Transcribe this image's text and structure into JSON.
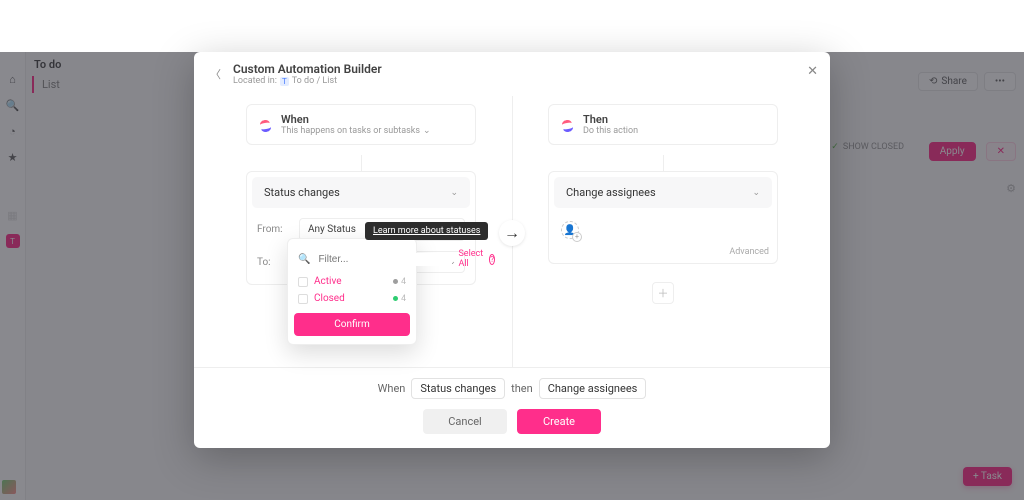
{
  "colors": {
    "accent": "#ff2e8b"
  },
  "background": {
    "title": "To do",
    "tab": "List",
    "share": "Share",
    "apply": "Apply",
    "show_closed": "SHOW CLOSED",
    "add_task": "+ Task"
  },
  "modal": {
    "title": "Custom Automation Builder",
    "located_prefix": "Located in:",
    "located_badge": "T",
    "located_path": "To do / List",
    "when": {
      "title": "When",
      "subtitle": "This happens on tasks or subtasks",
      "trigger": "Status changes",
      "from_label": "From:",
      "from_value": "Any Status",
      "to_label": "To:"
    },
    "then": {
      "title": "Then",
      "subtitle": "Do this action",
      "action": "Change assignees",
      "advanced": "Advanced"
    },
    "dropdown": {
      "placeholder": "Filter...",
      "select_all": "Select All",
      "options": [
        {
          "label": "Active",
          "count": 4,
          "dot": "grey"
        },
        {
          "label": "Closed",
          "count": 4,
          "dot": "green"
        }
      ],
      "confirm": "Confirm"
    },
    "tooltip": "Learn more about statuses",
    "summary": {
      "when": "When",
      "trigger": "Status changes",
      "then": "then",
      "action": "Change assignees"
    },
    "cancel": "Cancel",
    "create": "Create"
  }
}
